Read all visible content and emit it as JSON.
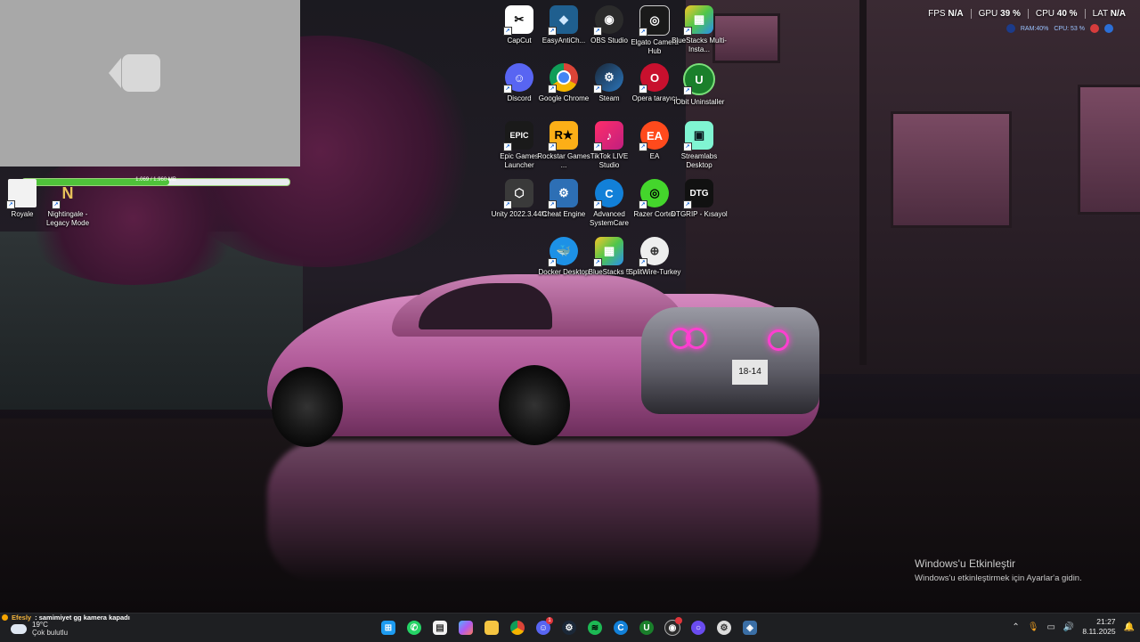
{
  "overlay": {
    "progress_text": "1.069 / 1.960 MB",
    "progress_value": 0.55
  },
  "stats": {
    "fps_label": "FPS",
    "fps_value": "N/A",
    "gpu_label": "GPU",
    "gpu_value": "39 %",
    "cpu_label": "CPU",
    "cpu_value": "40 %",
    "lat_label": "LAT",
    "lat_value": "N/A",
    "ram": "RAM:40%",
    "cpu_small": "CPU: 53 %"
  },
  "desktop_icons": [
    {
      "label": "CapCut"
    },
    {
      "label": "EasyAntiCh..."
    },
    {
      "label": "OBS Studio"
    },
    {
      "label": "Elgato Camera Hub"
    },
    {
      "label": "BlueStacks Multi-Insta..."
    },
    {
      "label": "Discord"
    },
    {
      "label": "Google Chrome"
    },
    {
      "label": "Steam"
    },
    {
      "label": "Opera tarayıcı"
    },
    {
      "label": "IObit Uninstaller"
    },
    {
      "label": "Epic Games Launcher"
    },
    {
      "label": "Rockstar Games ..."
    },
    {
      "label": "TikTok LIVE Studio"
    },
    {
      "label": "EA"
    },
    {
      "label": "Streamlabs Desktop"
    },
    {
      "label": "Unity 2022.3.44f1"
    },
    {
      "label": "Cheat Engine"
    },
    {
      "label": "Advanced SystemCare"
    },
    {
      "label": "Razer Cortex"
    },
    {
      "label": "DTGRIP - Kısayol"
    },
    {
      "label": "Docker Desktop"
    },
    {
      "label": "BlueStacks 5"
    },
    {
      "label": "SplitWire-Turkey"
    },
    {
      "label": "Royale"
    },
    {
      "label": "Nightingale - Legacy Mode"
    }
  ],
  "activation": {
    "title": "Windows'u Etkinleştir",
    "subtitle": "Windows'u etkinleştirmek için Ayarlar'a gidin."
  },
  "notification": {
    "name": "Efesly",
    "message": ": samimiyet gg kamera kapadı"
  },
  "weather": {
    "temp": "19°C",
    "condition": "Çok bulutlu"
  },
  "taskbar": {
    "discord_badge": "1"
  },
  "clock": {
    "time": "21:27",
    "date": "8.11.2025"
  }
}
